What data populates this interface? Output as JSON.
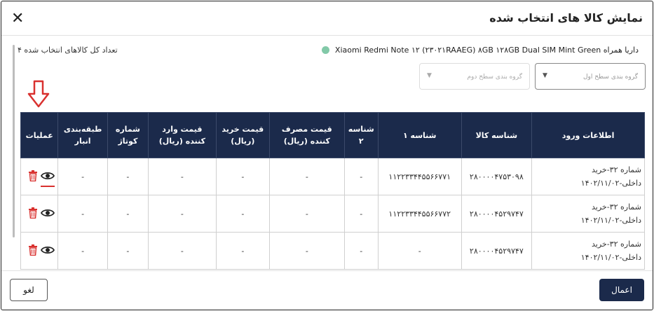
{
  "dialog": {
    "title": "نمایش کالا های انتخاب شده",
    "close_icon": "close-icon"
  },
  "summary": {
    "count_label": "تعداد کل کالاهای انتخاب شده ۴",
    "product_name": "داریا همراه Xiaomi Redmi Note ۱۲ (۲۳۰۲۱RAAEG) ۸GB ۱۲۸GB Dual SIM Mint Green",
    "dot_color": "#82c9a8"
  },
  "filters": {
    "first_placeholder": "گروه بندی سطح اول",
    "second_placeholder": "گروه بندی سطح دوم"
  },
  "table": {
    "headers": [
      "اطلاعات ورود",
      "شناسه کالا",
      "شناسه ۱",
      "شناسه ۲",
      "قیمت مصرف کننده (ریال)",
      "قیمت خرید (ریال)",
      "قیمت وارد کننده (ریال)",
      "شماره کوتاژ",
      "طبقه‌بندی انبار",
      "عملیات"
    ],
    "rows": [
      {
        "info_line1": "شماره ۳۲-خرید",
        "info_line2": "داخلی-۱۴۰۲/۱۱/۰۲",
        "sku": "۲۸۰۰۰۰۴۷۵۳۰۹۸",
        "id1": "۱۱۲۲۳۳۴۴۵۵۶۶۷۷۱",
        "id2": "-",
        "consumer_price": "-",
        "purchase_price": "-",
        "importer_price": "-",
        "cottage": "-",
        "warehouse": "-"
      },
      {
        "info_line1": "شماره ۳۲-خرید",
        "info_line2": "داخلی-۱۴۰۲/۱۱/۰۲",
        "sku": "۲۸۰۰۰۰۴۵۲۹۷۴۷",
        "id1": "۱۱۲۲۳۳۴۴۵۵۶۶۷۷۲",
        "id2": "-",
        "consumer_price": "-",
        "purchase_price": "-",
        "importer_price": "-",
        "cottage": "-",
        "warehouse": "-"
      },
      {
        "info_line1": "شماره ۳۲-خرید",
        "info_line2": "داخلی-۱۴۰۲/۱۱/۰۲",
        "sku": "۲۸۰۰۰۰۴۵۲۹۷۴۷",
        "id1": "-",
        "id2": "-",
        "consumer_price": "-",
        "purchase_price": "-",
        "importer_price": "-",
        "cottage": "-",
        "warehouse": "-"
      }
    ]
  },
  "footer": {
    "cancel_label": "لغو",
    "apply_label": "اعمال"
  },
  "colors": {
    "header_bg": "#1b2a4b",
    "trash": "#d9312f",
    "annotation_arrow": "#d9312f"
  }
}
